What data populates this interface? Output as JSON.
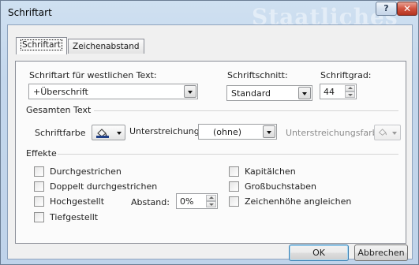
{
  "window": {
    "title": "Schriftart",
    "background_text": "Staatliches",
    "help_label": "?",
    "close_label": "✕"
  },
  "tabs": [
    {
      "label": "Schriftart",
      "active": true
    },
    {
      "label": "Zeichenabstand",
      "active": false
    }
  ],
  "font_section": {
    "western_font_label": "Schriftart für westlichen Text:",
    "western_font_value": "+Überschrift",
    "style_label": "Schriftschnitt:",
    "style_value": "Standard",
    "size_label": "Schriftgrad:",
    "size_value": "44"
  },
  "all_text": {
    "header": "Gesamten Text",
    "font_color_label": "Schriftfarbe",
    "underline_label": "Unterstreichung",
    "underline_value": "(ohne)",
    "underline_color_label": "Unterstreichungsfarbe"
  },
  "effects": {
    "header": "Effekte",
    "strikethrough": "Durchgestrichen",
    "double_strikethrough": "Doppelt durchgestrichen",
    "superscript": "Hochgestellt",
    "offset_label": "Abstand:",
    "offset_value": "0%",
    "subscript": "Tiefgestellt",
    "small_caps": "Kapitälchen",
    "all_caps": "Großbuchstaben",
    "equalize_height": "Zeichenhöhe angleichen"
  },
  "buttons": {
    "ok": "OK",
    "cancel": "Abbrechen"
  },
  "colors": {
    "font_color_swatch": "#1f3f88",
    "accent_frame": "#bfd3ea"
  }
}
